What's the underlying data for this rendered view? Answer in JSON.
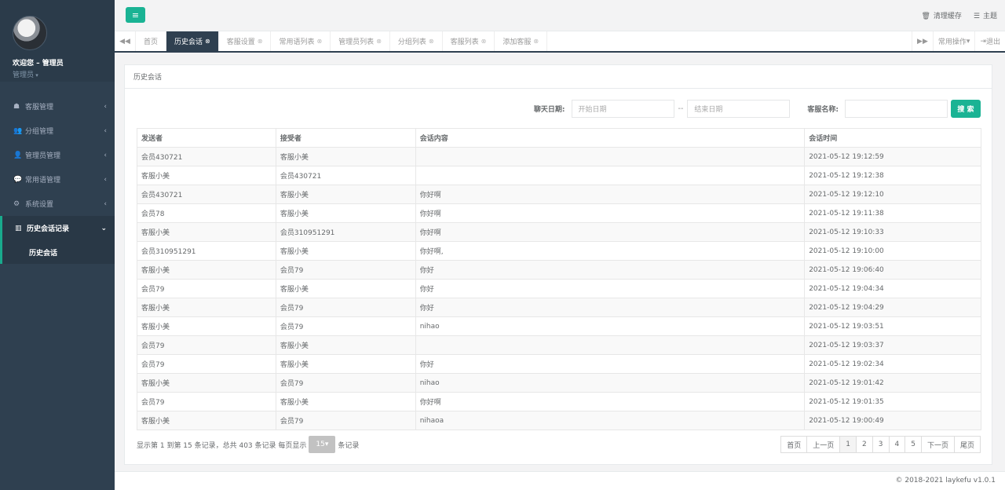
{
  "sidebar": {
    "welcome": "欢迎您 – 管理员",
    "role": "管理员",
    "items": [
      {
        "label": "客服管理",
        "icon": "ghost-icon",
        "glyph": "☗",
        "arrow": "‹"
      },
      {
        "label": "分组管理",
        "icon": "users-icon",
        "glyph": "👥",
        "arrow": "‹"
      },
      {
        "label": "管理员管理",
        "icon": "user-icon",
        "glyph": "👤",
        "arrow": "‹"
      },
      {
        "label": "常用语管理",
        "icon": "comments-icon",
        "glyph": "💬",
        "arrow": "‹"
      },
      {
        "label": "系统设置",
        "icon": "gear-icon",
        "glyph": "⚙",
        "arrow": "‹"
      },
      {
        "label": "历史会话记录",
        "icon": "bar-chart-icon",
        "glyph": "▥",
        "arrow": "⌄"
      }
    ],
    "subitem": "历史会话"
  },
  "topbar": {
    "menu_glyph": "≡",
    "clear_cache": "清理缓存",
    "theme": "主题"
  },
  "tabs": {
    "prev_glyph": "◀◀",
    "next_glyph": "▶▶",
    "items": [
      "首页",
      "历史会话",
      "客服设置",
      "常用语列表",
      "管理员列表",
      "分组列表",
      "客服列表",
      "添加客服"
    ],
    "common_ops": "常用操作",
    "logout": "退出"
  },
  "panel": {
    "title": "历史会话"
  },
  "search": {
    "date_label": "聊天日期:",
    "start_placeholder": "开始日期",
    "dash": "--",
    "end_placeholder": "结束日期",
    "name_label": "客服名称:",
    "name_value": "",
    "button": "搜 索"
  },
  "table": {
    "headers": [
      "发送者",
      "接受者",
      "会话内容",
      "会话时间"
    ],
    "rows": [
      [
        "会员430721",
        "客服小美",
        "",
        "2021-05-12 19:12:59"
      ],
      [
        "客服小美",
        "会员430721",
        "",
        "2021-05-12 19:12:38"
      ],
      [
        "会员430721",
        "客服小美",
        "你好啊",
        "2021-05-12 19:12:10"
      ],
      [
        "会员78",
        "客服小美",
        "你好啊",
        "2021-05-12 19:11:38"
      ],
      [
        "客服小美",
        "会员310951291",
        "你好啊",
        "2021-05-12 19:10:33"
      ],
      [
        "会员310951291",
        "客服小美",
        "你好啊,",
        "2021-05-12 19:10:00"
      ],
      [
        "客服小美",
        "会员79",
        "你好",
        "2021-05-12 19:06:40"
      ],
      [
        "会员79",
        "客服小美",
        "你好",
        "2021-05-12 19:04:34"
      ],
      [
        "客服小美",
        "会员79",
        "你好",
        "2021-05-12 19:04:29"
      ],
      [
        "客服小美",
        "会员79",
        "nihao",
        "2021-05-12 19:03:51"
      ],
      [
        "会员79",
        "客服小美",
        "",
        "2021-05-12 19:03:37"
      ],
      [
        "会员79",
        "客服小美",
        "你好",
        "2021-05-12 19:02:34"
      ],
      [
        "客服小美",
        "会员79",
        "nihao",
        "2021-05-12 19:01:42"
      ],
      [
        "会员79",
        "客服小美",
        "你好啊",
        "2021-05-12 19:01:35"
      ],
      [
        "客服小美",
        "会员79",
        "nihaoa",
        "2021-05-12 19:00:49"
      ]
    ]
  },
  "pagination": {
    "info_prefix": "显示第 1 到第 15 条记录，总共 403 条记录 每页显示",
    "page_size": "15",
    "info_suffix": "条记录",
    "first": "首页",
    "prev": "上一页",
    "pages": [
      "1",
      "2",
      "3",
      "4",
      "5"
    ],
    "next": "下一页",
    "last": "尾页"
  },
  "footer": "© 2018-2021 laykefu v1.0.1",
  "colors": {
    "sidebar": "#2f4050",
    "accent": "#1ab394"
  }
}
